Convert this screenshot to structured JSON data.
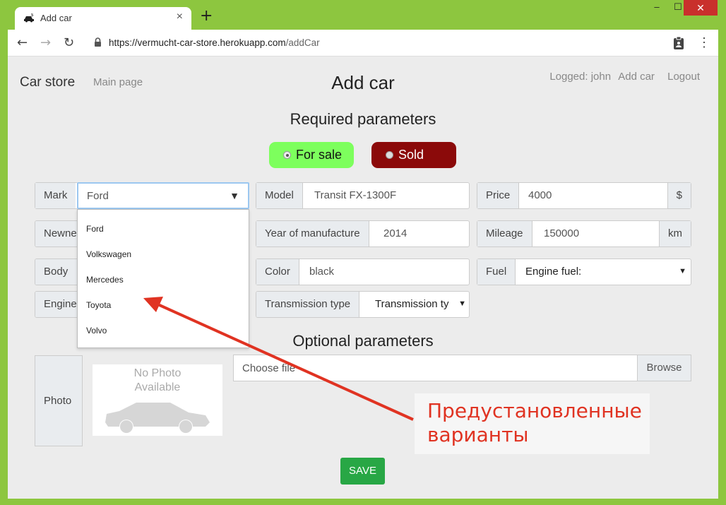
{
  "browser": {
    "tab_title": "Add car",
    "url_host": "https://vermucht-car-store.herokuapp.com",
    "url_path": "/addCar"
  },
  "nav": {
    "brand": "Car store",
    "main_page": "Main page",
    "logged": "Logged: john",
    "add_car": "Add car",
    "logout": "Logout"
  },
  "page_title": "Add car",
  "required_title": "Required parameters",
  "optional_title": "Optional parameters",
  "status": {
    "for_sale": "For sale",
    "sold": "Sold",
    "selected": "For sale"
  },
  "fields": {
    "mark_label": "Mark",
    "mark_value": "Ford",
    "model_label": "Model",
    "model_value": "Transit FX-1300F",
    "price_label": "Price",
    "price_value": "4000",
    "price_unit": "$",
    "newness_label": "Newne",
    "year_label": "Year of manufacture",
    "year_value": "2014",
    "mileage_label": "Mileage",
    "mileage_value": "150000",
    "mileage_unit": "km",
    "body_label": "Body ty",
    "color_label": "Color",
    "color_value": "black",
    "fuel_label": "Fuel",
    "fuel_value": "Engine fuel:",
    "engine_label": "Engine",
    "transmission_label": "Transmission type",
    "transmission_value": "Transmission tу"
  },
  "mark_options": [
    "Ford",
    "Volkswagen",
    "Mercedes",
    "Toyota",
    "Volvo"
  ],
  "photo": {
    "label": "Photo",
    "no_photo_line1": "No Photo",
    "no_photo_line2": "Available"
  },
  "file": {
    "placeholder": "Choose file",
    "browse": "Browse"
  },
  "save_label": "SAVE",
  "callout": {
    "line1": "Предустановленные",
    "line2": "варианты"
  },
  "colors": {
    "frame": "#8dc63f",
    "for_sale": "#7dff5d",
    "sold": "#8b0a0a",
    "save": "#28a745",
    "callout_text": "#e03322",
    "arrow": "#e03322"
  }
}
